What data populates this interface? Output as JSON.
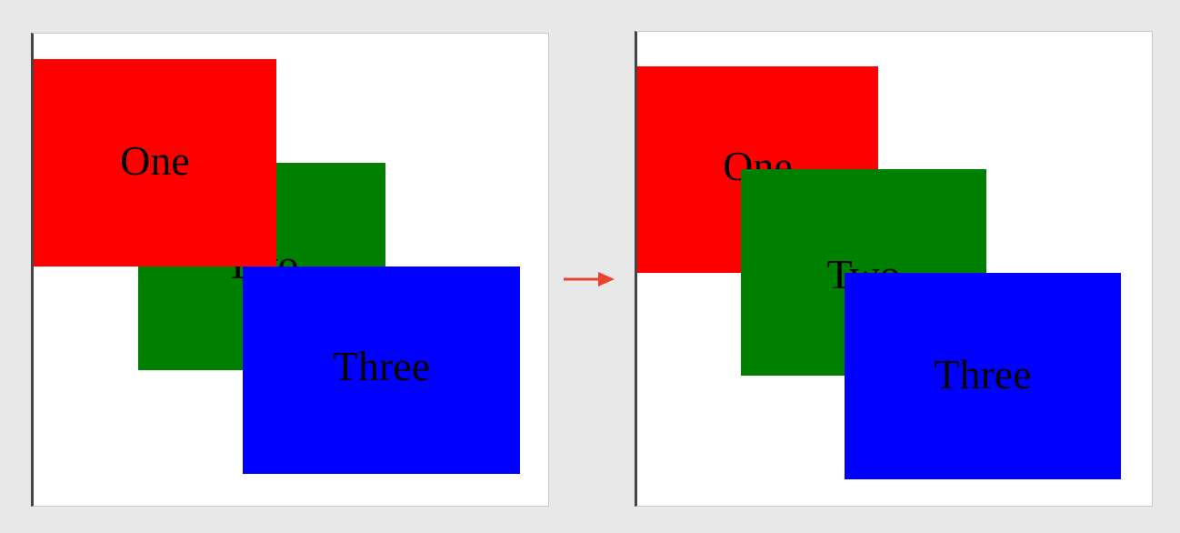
{
  "colors": {
    "one": "#ff0000",
    "two": "#008000",
    "three": "#0000ff",
    "arrow": "#e8432e",
    "background": "#e8e8e8"
  },
  "before": {
    "boxes": {
      "one": "One",
      "two": "Two",
      "three": "Three"
    }
  },
  "after": {
    "boxes": {
      "one": "One",
      "two": "Two",
      "three": "Three"
    }
  },
  "arrow_icon": "arrow-right-icon"
}
